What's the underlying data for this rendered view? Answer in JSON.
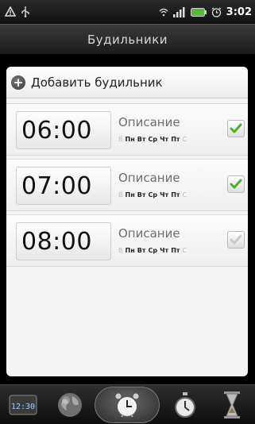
{
  "status_bar": {
    "time": "3:02",
    "icons": [
      "alert-icon",
      "usb-icon",
      "wifi-icon",
      "signal-icon",
      "battery-icon",
      "alarm-clock-icon"
    ]
  },
  "header": {
    "title": "Будильники"
  },
  "add_alarm": {
    "label": "Добавить будильник",
    "icon": "plus-icon"
  },
  "alarms": [
    {
      "time": "06:00",
      "description": "Описание",
      "days_prefix": "В",
      "days": [
        "Пн",
        "Вт",
        "Ср",
        "Чт",
        "Пт"
      ],
      "days_suffix": "С",
      "enabled": true
    },
    {
      "time": "07:00",
      "description": "Описание",
      "days_prefix": "В",
      "days": [
        "Пн",
        "Вт",
        "Ср",
        "Чт",
        "Пт"
      ],
      "days_suffix": "С",
      "enabled": true
    },
    {
      "time": "08:00",
      "description": "Описание",
      "days_prefix": "В",
      "days": [
        "Пн",
        "Вт",
        "Ср",
        "Чт",
        "Пт"
      ],
      "days_suffix": "С",
      "enabled": false
    }
  ],
  "bottom_tabs": [
    {
      "name": "tab-clock",
      "icon": "digital-clock-icon",
      "label": "12:30"
    },
    {
      "name": "tab-world-clock",
      "icon": "globe-icon"
    },
    {
      "name": "tab-alarm",
      "icon": "alarm-clock-icon",
      "active": true
    },
    {
      "name": "tab-stopwatch",
      "icon": "stopwatch-icon"
    },
    {
      "name": "tab-timer",
      "icon": "hourglass-icon"
    }
  ],
  "colors": {
    "check_on": "#4caf2a",
    "check_off": "#c9c9c9"
  }
}
